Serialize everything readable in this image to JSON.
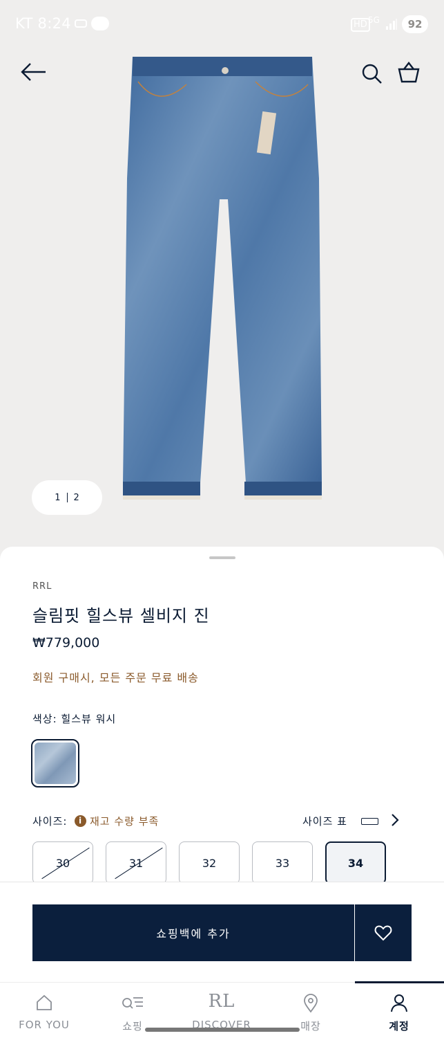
{
  "status_bar": {
    "carrier_time": "KT 8:24",
    "hd": "HD",
    "network": "5G",
    "battery": "92"
  },
  "gallery": {
    "pager_current": "1",
    "pager_total": "2"
  },
  "product": {
    "brand": "RRL",
    "name": "슬림핏 힐스뷰 셀비지 진",
    "price": "₩779,000",
    "promo": "회원 구매시, 모든 주문 무료 배송",
    "color_label": "색상: 힐스뷰 워시",
    "size_label": "사이즈:",
    "stock_warning": "재고 수량 부족",
    "size_chart_label": "사이즈 표",
    "sizes": [
      {
        "label": "30",
        "available": false
      },
      {
        "label": "31",
        "available": false
      },
      {
        "label": "32",
        "available": true
      },
      {
        "label": "33",
        "available": true
      },
      {
        "label": "34",
        "available": true,
        "selected": true
      }
    ]
  },
  "actions": {
    "add_to_bag": "쇼핑백에 추가"
  },
  "tabs": [
    {
      "label": "FOR YOU",
      "icon": "home-icon"
    },
    {
      "label": "쇼핑",
      "icon": "shop-search-icon"
    },
    {
      "label": "DISCOVER",
      "icon": "rl-logo",
      "logo_text": "RL"
    },
    {
      "label": "매장",
      "icon": "location-pin-icon"
    },
    {
      "label": "계정",
      "icon": "account-icon",
      "active": true
    }
  ],
  "colors": {
    "navy": "#0b1f3d",
    "promo_brown": "#8a5a2b",
    "background": "#efeeed"
  }
}
